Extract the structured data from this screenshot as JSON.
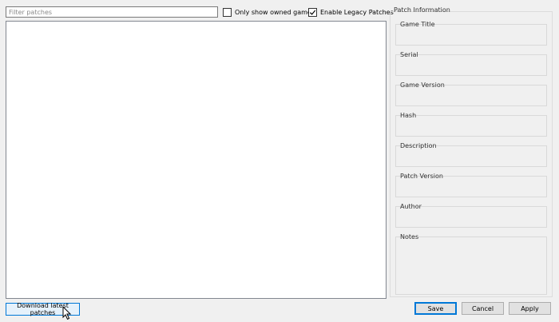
{
  "filter": {
    "placeholder": "Filter patches",
    "value": ""
  },
  "options": {
    "only_owned": {
      "label": "Only show owned games",
      "checked": false
    },
    "legacy": {
      "label": "Enable Legacy Patches",
      "checked": true
    }
  },
  "panel": {
    "title": "Patch Information",
    "fields": [
      {
        "label": "Game Title",
        "value": ""
      },
      {
        "label": "Serial",
        "value": ""
      },
      {
        "label": "Game Version",
        "value": ""
      },
      {
        "label": "Hash",
        "value": ""
      },
      {
        "label": "Description",
        "value": ""
      },
      {
        "label": "Patch Version",
        "value": ""
      },
      {
        "label": "Author",
        "value": ""
      },
      {
        "label": "Notes",
        "value": ""
      }
    ]
  },
  "buttons": {
    "download": "Download latest patches",
    "save": "Save",
    "cancel": "Cancel",
    "apply": "Apply"
  },
  "colors": {
    "accent": "#0078d7",
    "background": "#f0f0f0"
  }
}
